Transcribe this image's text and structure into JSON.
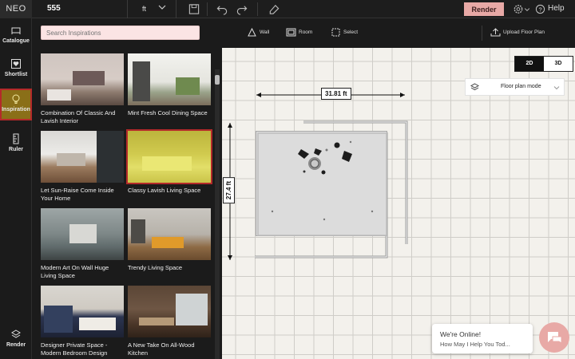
{
  "app": {
    "logo": "NEO",
    "project_name": "555"
  },
  "toolbar": {
    "unit": "ft",
    "render_label": "Render",
    "help_label": "Help"
  },
  "rail": {
    "items": [
      {
        "label": "Catalogue",
        "icon": "sofa-icon"
      },
      {
        "label": "Shortlist",
        "icon": "heart-icon"
      },
      {
        "label": "Inspiration",
        "icon": "bulb-icon"
      },
      {
        "label": "Ruler",
        "icon": "ruler-icon"
      }
    ],
    "bottom": {
      "label": "Render",
      "icon": "render-icon"
    }
  },
  "inspiration": {
    "search_placeholder": "Search Inspirations",
    "cards": [
      {
        "title": "Combination Of Classic And Lavish Interior"
      },
      {
        "title": "Mint Fresh Cool Dining Space"
      },
      {
        "title": "Let Sun-Raise Come Inside Your Home"
      },
      {
        "title": "Classy Lavish Living Space",
        "selected": true
      },
      {
        "title": "Modern Art On Wall Huge Living Space"
      },
      {
        "title": "Trendy Living Space"
      },
      {
        "title": "Designer Private Space - Modern Bedroom Design"
      },
      {
        "title": "A New Take On All-Wood Kitchen"
      }
    ]
  },
  "canvas_toolbar": {
    "wall": "Wall",
    "room": "Room",
    "select": "Select",
    "upload": "Upload Floor Plan"
  },
  "view": {
    "mode_2d": "2D",
    "mode_3d": "3D",
    "active": "2D",
    "floor_plan_mode": "Floor plan mode"
  },
  "dimensions": {
    "width": "31.81 ft",
    "height": "27.4 ft"
  },
  "chat": {
    "line1": "We're Online!",
    "line2": "How May I Help You Tod..."
  },
  "colors": {
    "accent": "#e8a9a6",
    "selection": "#b42a2a"
  }
}
